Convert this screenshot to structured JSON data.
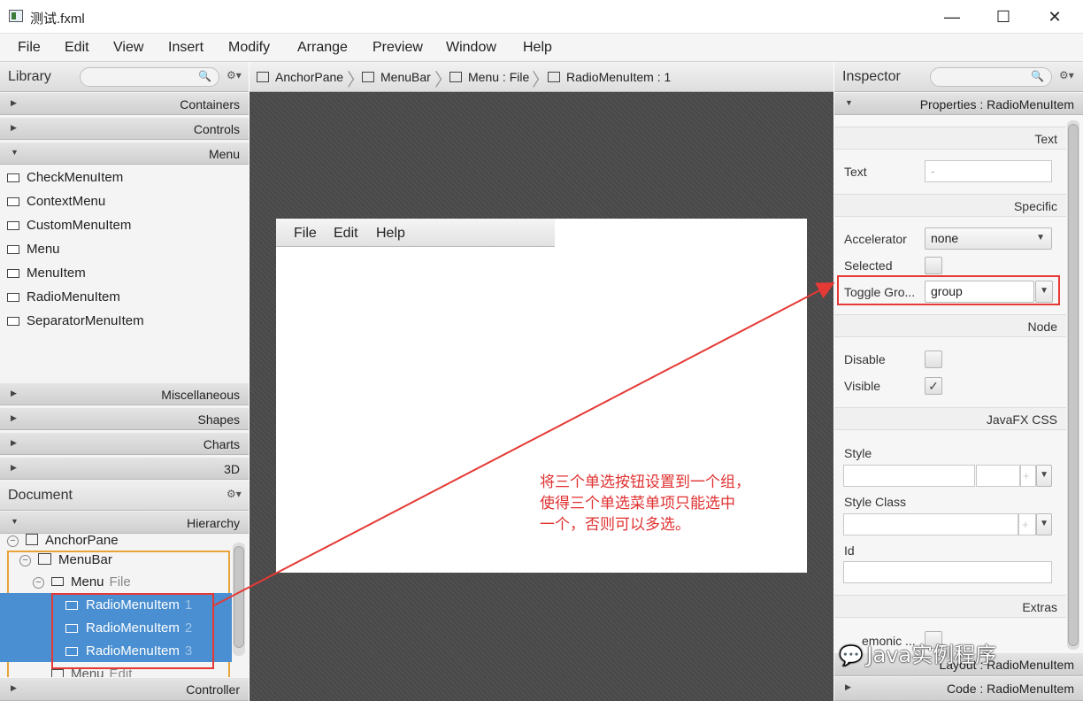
{
  "window": {
    "title": "测试.fxml",
    "min": "—",
    "max": "☐",
    "close": "✕"
  },
  "menubar": [
    "File",
    "Edit",
    "View",
    "Insert",
    "Modify",
    "Arrange",
    "Preview",
    "Window",
    "Help"
  ],
  "library": {
    "title": "Library",
    "gear": "⚙▾",
    "sections_top": [
      {
        "label": "Containers",
        "state": "collapsed"
      },
      {
        "label": "Controls",
        "state": "collapsed"
      },
      {
        "label": "Menu",
        "state": "expanded"
      }
    ],
    "items": [
      "CheckMenuItem",
      "ContextMenu",
      "CustomMenuItem",
      "Menu",
      "MenuItem",
      "RadioMenuItem",
      "SeparatorMenuItem"
    ],
    "sections_bottom": [
      "Miscellaneous",
      "Shapes",
      "Charts",
      "3D"
    ]
  },
  "document": {
    "title": "Document",
    "gear": "⚙▾",
    "hierarchy_label": "Hierarchy",
    "controller_label": "Controller",
    "tree": {
      "root": "AnchorPane",
      "menubar": "MenuBar",
      "menu": "Menu",
      "menu_text": "File",
      "items": [
        {
          "label": "RadioMenuItem",
          "text": "1"
        },
        {
          "label": "RadioMenuItem",
          "text": "2"
        },
        {
          "label": "RadioMenuItem",
          "text": "3"
        }
      ],
      "next": "Menu",
      "next_text": "Edit"
    }
  },
  "breadcrumb": [
    "AnchorPane",
    "MenuBar",
    "Menu : File",
    "RadioMenuItem : 1"
  ],
  "preview": {
    "menus": [
      "File",
      "Edit",
      "Help"
    ]
  },
  "annotation": [
    "将三个单选按钮设置到一个组，",
    "使得三个单选菜单项只能选中",
    "一个，否则可以多选。"
  ],
  "inspector": {
    "title": "Inspector",
    "gear": "⚙▾",
    "properties_header": "Properties : RadioMenuItem",
    "groups": {
      "text": "Text",
      "specific": "Specific",
      "node": "Node",
      "css": "JavaFX CSS",
      "extras": "Extras"
    },
    "text_label": "Text",
    "text_placeholder": "-",
    "accelerator_label": "Accelerator",
    "accelerator_value": "none",
    "selected_label": "Selected",
    "selected": false,
    "toggle_group_label": "Toggle Gro...",
    "toggle_group_value": "group",
    "disable_label": "Disable",
    "visible_label": "Visible",
    "visible": true,
    "style_label": "Style",
    "style_class_label": "Style Class",
    "id_label": "Id",
    "mnemonic_label": "emonic ...",
    "layout_header": "Layout : RadioMenuItem",
    "code_header": "Code : RadioMenuItem"
  },
  "watermark": "Java实例程序"
}
